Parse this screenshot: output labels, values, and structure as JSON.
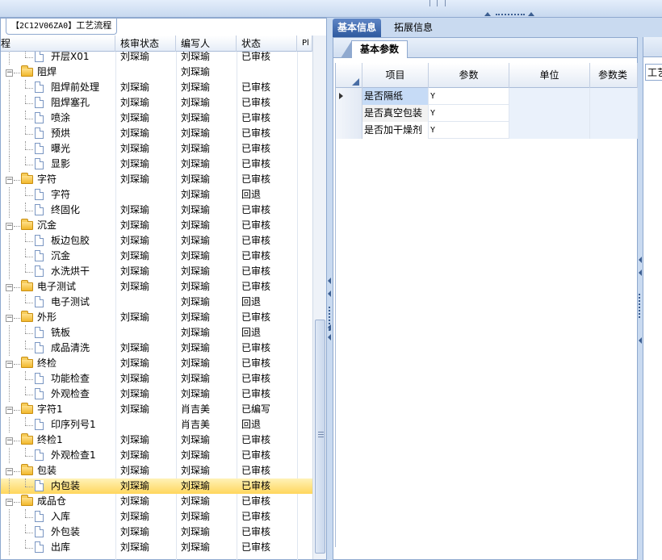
{
  "left_panel": {
    "tab_code": "【2C12V06ZA0】",
    "tab_title": "工艺流程",
    "columns": [
      "程",
      "核审状态",
      "编写人",
      "状态",
      "Pl"
    ]
  },
  "tree_rows": [
    {
      "name": "开层X01",
      "level": 1,
      "type": "doc",
      "rev": "刘琛瑜",
      "author": "刘琛瑜",
      "status": "已审核",
      "selected": false,
      "partial": true
    },
    {
      "name": "阻焊",
      "level": 0,
      "type": "folder",
      "rev": "",
      "author": "刘琛瑜",
      "status": "",
      "selected": false
    },
    {
      "name": "阻焊前处理",
      "level": 1,
      "type": "doc",
      "rev": "刘琛瑜",
      "author": "刘琛瑜",
      "status": "已审核",
      "selected": false
    },
    {
      "name": "阻焊塞孔",
      "level": 1,
      "type": "doc",
      "rev": "刘琛瑜",
      "author": "刘琛瑜",
      "status": "已审核",
      "selected": false
    },
    {
      "name": "喷涂",
      "level": 1,
      "type": "doc",
      "rev": "刘琛瑜",
      "author": "刘琛瑜",
      "status": "已审核",
      "selected": false
    },
    {
      "name": "预烘",
      "level": 1,
      "type": "doc",
      "rev": "刘琛瑜",
      "author": "刘琛瑜",
      "status": "已审核",
      "selected": false
    },
    {
      "name": "曝光",
      "level": 1,
      "type": "doc",
      "rev": "刘琛瑜",
      "author": "刘琛瑜",
      "status": "已审核",
      "selected": false
    },
    {
      "name": "显影",
      "level": 1,
      "type": "doc",
      "rev": "刘琛瑜",
      "author": "刘琛瑜",
      "status": "已审核",
      "selected": false
    },
    {
      "name": "字符",
      "level": 0,
      "type": "folder",
      "rev": "刘琛瑜",
      "author": "刘琛瑜",
      "status": "已审核",
      "selected": false
    },
    {
      "name": "字符",
      "level": 1,
      "type": "doc",
      "rev": "",
      "author": "刘琛瑜",
      "status": "回退",
      "selected": false
    },
    {
      "name": "终固化",
      "level": 1,
      "type": "doc",
      "rev": "刘琛瑜",
      "author": "刘琛瑜",
      "status": "已审核",
      "selected": false
    },
    {
      "name": "沉金",
      "level": 0,
      "type": "folder",
      "rev": "刘琛瑜",
      "author": "刘琛瑜",
      "status": "已审核",
      "selected": false
    },
    {
      "name": "板边包胶",
      "level": 1,
      "type": "doc",
      "rev": "刘琛瑜",
      "author": "刘琛瑜",
      "status": "已审核",
      "selected": false
    },
    {
      "name": "沉金",
      "level": 1,
      "type": "doc",
      "rev": "刘琛瑜",
      "author": "刘琛瑜",
      "status": "已审核",
      "selected": false
    },
    {
      "name": "水洗烘干",
      "level": 1,
      "type": "doc",
      "rev": "刘琛瑜",
      "author": "刘琛瑜",
      "status": "已审核",
      "selected": false
    },
    {
      "name": "电子测试",
      "level": 0,
      "type": "folder",
      "rev": "刘琛瑜",
      "author": "刘琛瑜",
      "status": "已审核",
      "selected": false
    },
    {
      "name": "电子测试",
      "level": 1,
      "type": "doc",
      "rev": "",
      "author": "刘琛瑜",
      "status": "回退",
      "selected": false
    },
    {
      "name": "外形",
      "level": 0,
      "type": "folder",
      "rev": "刘琛瑜",
      "author": "刘琛瑜",
      "status": "已审核",
      "selected": false
    },
    {
      "name": "铣板",
      "level": 1,
      "type": "doc",
      "rev": "",
      "author": "刘琛瑜",
      "status": "回退",
      "selected": false
    },
    {
      "name": "成品清洗",
      "level": 1,
      "type": "doc",
      "rev": "刘琛瑜",
      "author": "刘琛瑜",
      "status": "已审核",
      "selected": false
    },
    {
      "name": "终检",
      "level": 0,
      "type": "folder",
      "rev": "刘琛瑜",
      "author": "刘琛瑜",
      "status": "已审核",
      "selected": false
    },
    {
      "name": "功能检查",
      "level": 1,
      "type": "doc",
      "rev": "刘琛瑜",
      "author": "刘琛瑜",
      "status": "已审核",
      "selected": false
    },
    {
      "name": "外观检查",
      "level": 1,
      "type": "doc",
      "rev": "刘琛瑜",
      "author": "刘琛瑜",
      "status": "已审核",
      "selected": false
    },
    {
      "name": "字符1",
      "level": 0,
      "type": "folder",
      "rev": "刘琛瑜",
      "author": "肖吉美",
      "status": "已编写",
      "selected": false
    },
    {
      "name": "印序列号1",
      "level": 1,
      "type": "doc",
      "rev": "",
      "author": "肖吉美",
      "status": "回退",
      "selected": false
    },
    {
      "name": "终检1",
      "level": 0,
      "type": "folder",
      "rev": "刘琛瑜",
      "author": "刘琛瑜",
      "status": "已审核",
      "selected": false
    },
    {
      "name": "外观检查1",
      "level": 1,
      "type": "doc",
      "rev": "刘琛瑜",
      "author": "刘琛瑜",
      "status": "已审核",
      "selected": false
    },
    {
      "name": "包装",
      "level": 0,
      "type": "folder",
      "rev": "刘琛瑜",
      "author": "刘琛瑜",
      "status": "已审核",
      "selected": false
    },
    {
      "name": "内包装",
      "level": 1,
      "type": "doc",
      "rev": "刘琛瑜",
      "author": "刘琛瑜",
      "status": "已审核",
      "selected": true
    },
    {
      "name": "成品仓",
      "level": 0,
      "type": "folder",
      "rev": "刘琛瑜",
      "author": "刘琛瑜",
      "status": "已审核",
      "selected": false
    },
    {
      "name": "入库",
      "level": 1,
      "type": "doc",
      "rev": "刘琛瑜",
      "author": "刘琛瑜",
      "status": "已审核",
      "selected": false
    },
    {
      "name": "外包装",
      "level": 1,
      "type": "doc",
      "rev": "刘琛瑜",
      "author": "刘琛瑜",
      "status": "已审核",
      "selected": false
    },
    {
      "name": "出库",
      "level": 1,
      "type": "doc",
      "rev": "刘琛瑜",
      "author": "刘琛瑜",
      "status": "已审核",
      "selected": false
    }
  ],
  "right_panel": {
    "tabs": [
      "基本信息",
      "拓展信息"
    ],
    "active_tab": 0,
    "sub_tab": "基本参数",
    "param_columns": [
      "项目",
      "参数",
      "单位",
      "参数类"
    ],
    "params": [
      {
        "item": "是否隔纸",
        "value": "Y",
        "unit": "",
        "highlighted": true
      },
      {
        "item": "是否真空包装",
        "value": "Y",
        "unit": "",
        "highlighted": false
      },
      {
        "item": "是否加干燥剂",
        "value": "Y",
        "unit": "",
        "highlighted": false
      }
    ],
    "far_label": "工艺"
  },
  "colors": {
    "accent": "#2f5a9f",
    "frame": "#c9daf0",
    "selected_row": "#ffd65c",
    "highlight_cell": "#c6dbf6"
  }
}
